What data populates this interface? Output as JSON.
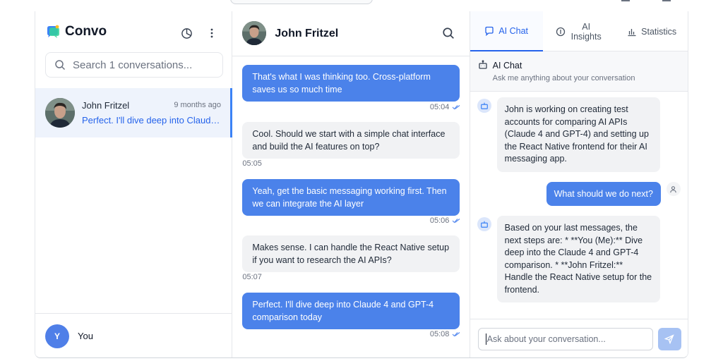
{
  "sidebar": {
    "app_name": "Convo",
    "search_placeholder": "Search 1 conversations...",
    "conversations": [
      {
        "name": "John Fritzel",
        "time": "9 months ago",
        "preview": "Perfect. I'll dive deep into Claude..."
      }
    ],
    "user": {
      "initial": "Y",
      "name": "You"
    }
  },
  "chat": {
    "contact_name": "John Fritzel",
    "messages": [
      {
        "dir": "out",
        "text": "That's what I was thinking too. Cross-platform saves us so much time",
        "time": "05:04"
      },
      {
        "dir": "in",
        "text": "Cool. Should we start with a simple chat interface and build the AI features on top?",
        "time": "05:05"
      },
      {
        "dir": "out",
        "text": "Yeah, get the basic messaging working first. Then we can integrate the AI layer",
        "time": "05:06"
      },
      {
        "dir": "in",
        "text": "Makes sense. I can handle the React Native setup if you want to research the AI APIs?",
        "time": "05:07"
      },
      {
        "dir": "out",
        "text": "Perfect. I'll dive deep into Claude 4 and GPT-4 comparison today",
        "time": "05:08"
      }
    ]
  },
  "assistant": {
    "tabs": [
      {
        "label": "AI Chat",
        "icon": "chat-bubble-icon",
        "active": true
      },
      {
        "label": "AI Insights",
        "icon": "info-circle-icon",
        "active": false
      },
      {
        "label": "Statistics",
        "icon": "bar-chart-icon",
        "active": false
      }
    ],
    "header_title": "AI Chat",
    "header_subtitle": "Ask me anything about your conversation",
    "messages": [
      {
        "role": "ai",
        "text": "John is working on creating test accounts for comparing AI APIs (Claude 4 and GPT-4) and setting up the React Native frontend for their AI messaging app."
      },
      {
        "role": "user",
        "text": "What should we do next?"
      },
      {
        "role": "ai",
        "text": "Based on your last messages, the next steps are: * **You (Me):** Dive deep into the Claude 4 and GPT-4 comparison. * **John Fritzel:** Handle the React Native setup for the frontend."
      }
    ],
    "input_placeholder": "Ask about your conversation..."
  },
  "colors": {
    "accent": "#2563eb",
    "outgoing_bubble": "#4b82ea",
    "incoming_bubble": "#f1f2f4",
    "selected_row": "#eef3fc",
    "send_disabled": "#a7c2f3"
  }
}
